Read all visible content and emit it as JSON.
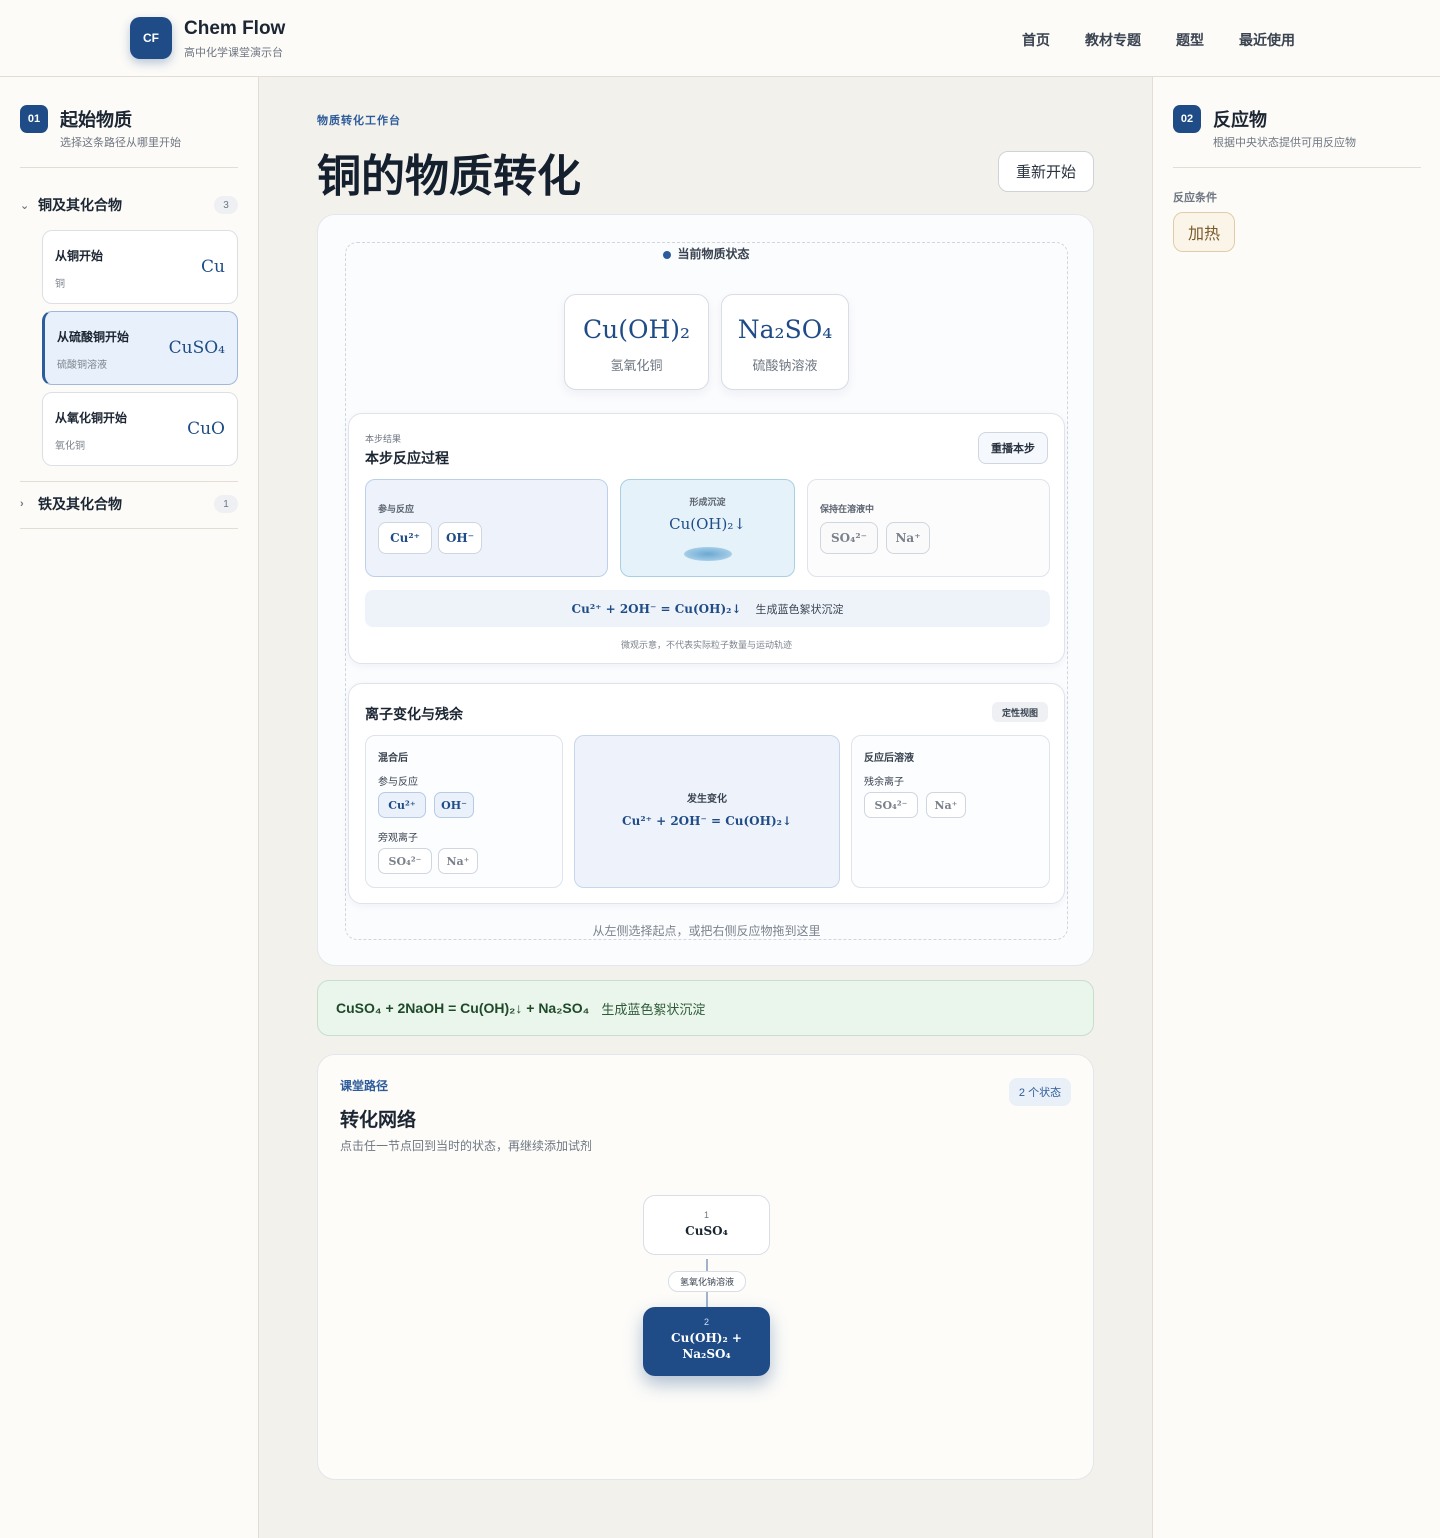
{
  "header": {
    "logo": "CF",
    "app_name": "Chem Flow",
    "app_sub": "高中化学课堂演示台",
    "nav": [
      "首页",
      "教材专题",
      "题型",
      "最近使用"
    ]
  },
  "left": {
    "step": "01",
    "title": "起始物质",
    "subtitle": "选择这条路径从哪里开始",
    "groups": [
      {
        "name": "铜及其化合物",
        "count": "3",
        "expanded": true
      },
      {
        "name": "铁及其化合物",
        "count": "1",
        "expanded": false
      }
    ],
    "starts": [
      {
        "title": "从铜开始",
        "sub": "铜",
        "formula": "Cu",
        "active": false
      },
      {
        "title": "从硫酸铜开始",
        "sub": "硫酸铜溶液",
        "formula": "CuSO₄",
        "active": true
      },
      {
        "title": "从氧化铜开始",
        "sub": "氧化铜",
        "formula": "CuO",
        "active": false
      }
    ]
  },
  "right": {
    "step": "02",
    "title": "反应物",
    "subtitle": "根据中央状态提供可用反应物",
    "condition_label": "反应条件",
    "condition": "加热"
  },
  "main": {
    "kicker": "物质转化工作台",
    "title": "铜的物质转化",
    "restart": "重新开始",
    "state_label": "当前物质状态",
    "substances": [
      {
        "formula": "Cu(OH)₂",
        "name": "氢氧化铜"
      },
      {
        "formula": "Na₂SO₄",
        "name": "硫酸钠溶液"
      }
    ],
    "process": {
      "kicker": "本步结果",
      "title": "本步反应过程",
      "replay": "重播本步",
      "react_label": "参与反应",
      "react_ions": [
        "Cu²⁺",
        "OH⁻"
      ],
      "precip_label": "形成沉淀",
      "precip": "Cu(OH)₂↓",
      "remain_label": "保持在溶液中",
      "remain_ions": [
        "SO₄²⁻",
        "Na⁺"
      ],
      "equation": "Cu²⁺ + 2OH⁻ = Cu(OH)₂↓",
      "equation_note": "生成蓝色絮状沉淀",
      "micro_note": "微观示意，不代表实际粒子数量与运动轨迹"
    },
    "ions": {
      "title": "离子变化与残余",
      "tag": "定性视图",
      "mixed_label": "混合后",
      "react_label": "参与反应",
      "react_ions": [
        "Cu²⁺",
        "OH⁻"
      ],
      "spectator_label": "旁观离子",
      "spectator_ions": [
        "SO₄²⁻",
        "Na⁺"
      ],
      "change_label": "发生变化",
      "change_eq": "Cu²⁺ + 2OH⁻ = Cu(OH)₂↓",
      "after_label": "反应后溶液",
      "residual_label": "残余离子",
      "residual_ions": [
        "SO₄²⁻",
        "Na⁺"
      ]
    },
    "drop_hint": "从左侧选择起点，或把右侧反应物拖到这里",
    "result_equation": "CuSO₄ + 2NaOH = Cu(OH)₂↓ + Na₂SO₄",
    "result_note": "生成蓝色絮状沉淀"
  },
  "network": {
    "kicker": "课堂路径",
    "title": "转化网络",
    "subtitle": "点击任一节点回到当时的状态，再继续添加试剂",
    "count": "2 个状态",
    "nodes": [
      {
        "num": "1",
        "line1": "CuSO₄",
        "line2": ""
      },
      {
        "num": "2",
        "line1": "Cu(OH)₂ +",
        "line2": "Na₂SO₄"
      }
    ],
    "edge_label": "氢氧化钠溶液"
  },
  "colors": {
    "brand": "#1f4c86",
    "accent": "#2d5c9a",
    "success_bg": "#eaf5ec",
    "condition_bg": "#fbf5e9"
  }
}
